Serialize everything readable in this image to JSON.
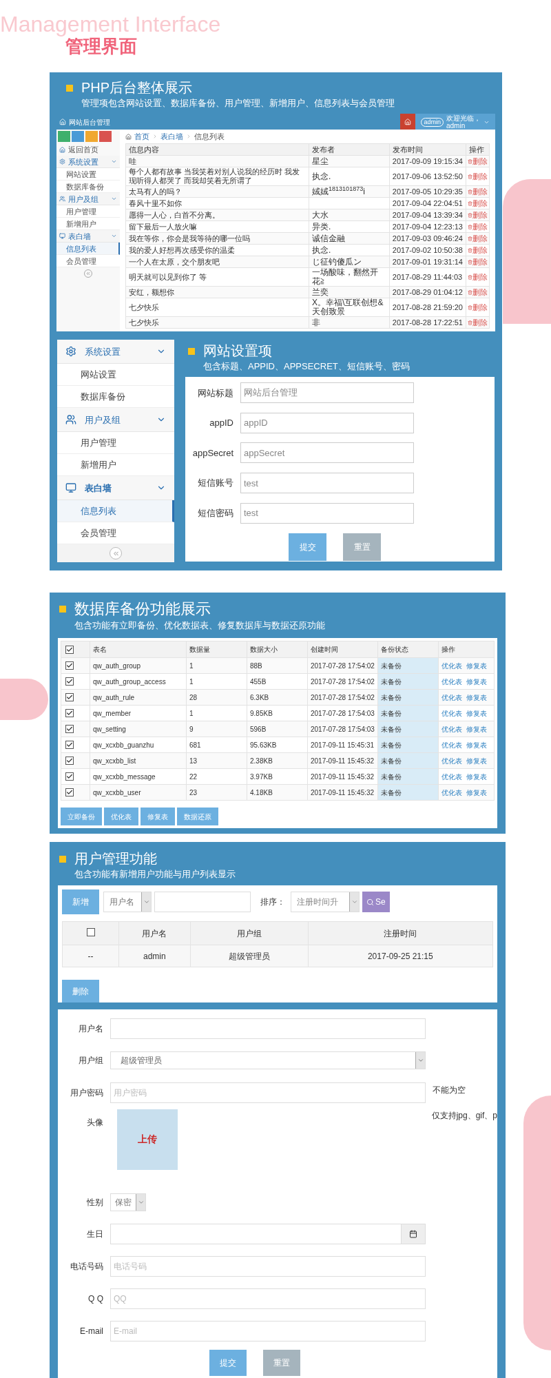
{
  "header": {
    "english": "Management Interface",
    "title": "管理界面"
  },
  "overview": {
    "title": "PHP后台整体展示",
    "subtitle": "管理项包含网站设置、数据库备份、用户管理、新增用户、信息列表与会员管理",
    "app_title": "网站后台管理",
    "avatar": "admin",
    "greeting": "欢迎光临，",
    "user": "admin",
    "toolbar": [
      {
        "color": "#3fb06c"
      },
      {
        "color": "#4a9ad6"
      },
      {
        "color": "#f0a830"
      },
      {
        "color": "#d9534f"
      }
    ],
    "breadcrumb": [
      "首页",
      "表白墙",
      "信息列表"
    ],
    "home_link": "返回首页",
    "sidebar": [
      {
        "label": "系统设置",
        "expanded": true,
        "children": [
          {
            "label": "网站设置",
            "selected": false
          },
          {
            "label": "数据库备份",
            "selected": false
          }
        ]
      },
      {
        "label": "用户及组",
        "expanded": true,
        "children": [
          {
            "label": "用户管理",
            "selected": false
          },
          {
            "label": "新增用户",
            "selected": false
          }
        ]
      },
      {
        "label": "表白墙",
        "expanded": true,
        "children": [
          {
            "label": "信息列表",
            "selected": true
          },
          {
            "label": "会员管理",
            "selected": false
          }
        ]
      }
    ],
    "columns": [
      "信息内容",
      "发布者",
      "发布时间",
      "操作"
    ],
    "rows": [
      {
        "content": "哇",
        "author": "星尘",
        "time": "2017-09-09 19:15:34",
        "action": "删除"
      },
      {
        "content": "每个人都有故事 当我笑着对别人说我的经历时 我发现听得人都哭了 而我却笑着无所谓了",
        "author": "执念.",
        "time": "2017-09-06 13:52:50",
        "action": "删除"
      },
      {
        "content": "太马有人的吗？",
        "author": "娀娀$^{1813101873}$i",
        "time": "2017-09-05 10:29:35",
        "action": "删除"
      },
      {
        "content": "春风十里不如你",
        "time": "2017-09-04 22:04:51",
        "action": "删除"
      },
      {
        "content": "愿得一人心，白首不分离。",
        "author": "大水",
        "time": "2017-09-04 13:39:34",
        "action": "删除"
      },
      {
        "content": "留下最后一人放火嘛",
        "author": "异类.",
        "time": "2017-09-04 12:23:13",
        "action": "删除"
      },
      {
        "content": "我在等你，你会是我等待的哪一位吗",
        "author": "诚信金融",
        "time": "2017-09-03 09:46:24",
        "action": "删除"
      },
      {
        "content": "我的爱人好想再次感受你的温柔",
        "author": "执念.",
        "time": "2017-09-02 10:50:38",
        "action": "删除"
      },
      {
        "content": "一个人在太原，交个朋友吧",
        "author": "じ征钓傻瓜ン",
        "time": "2017-09-01 19:31:14",
        "action": "删除"
      },
      {
        "content": "明天就可以见到你了 等",
        "author": "一场酸味，翻然开花≧",
        "time": "2017-08-29 11:44:03",
        "action": "删除"
      },
      {
        "content": "安红，额想你",
        "author": "兰奕",
        "time": "2017-08-29 01:04:12",
        "action": "删除"
      },
      {
        "content": "七夕快乐",
        "author": "X。幸福\\互联创想&天创致景",
        "time": "2017-08-28 21:59:20",
        "action": "删除"
      },
      {
        "content": "七夕快乐",
        "author": "非",
        "time": "2017-08-28 17:22:51",
        "action": "删除"
      }
    ]
  },
  "settings": {
    "title": "网站设置项",
    "subtitle": "包含标题、APPID、APPSECRET、短信账号、密码",
    "sidebar": [
      {
        "label": "系统设置",
        "expanded": true,
        "children": [
          {
            "label": "网站设置",
            "selected": false
          },
          {
            "label": "数据库备份",
            "selected": false
          }
        ]
      },
      {
        "label": "用户及组",
        "expanded": true,
        "children": [
          {
            "label": "用户管理",
            "selected": false
          },
          {
            "label": "新增用户",
            "selected": false
          }
        ]
      },
      {
        "label": "表白墙",
        "expanded": true,
        "children": [
          {
            "label": "信息列表",
            "selected": true
          },
          {
            "label": "会员管理",
            "selected": false
          }
        ]
      }
    ],
    "fields": [
      {
        "label": "网站标题",
        "value": "网站后台管理"
      },
      {
        "label": "appID",
        "value": "appID"
      },
      {
        "label": "appSecret",
        "value": "appSecret"
      },
      {
        "label": "短信账号",
        "value": "test"
      },
      {
        "label": "短信密码",
        "value": "test"
      }
    ],
    "buttons": [
      {
        "label": "提交",
        "kind": "primary"
      },
      {
        "label": "重置",
        "kind": "secondary"
      }
    ]
  },
  "backup": {
    "title": "数据库备份功能展示",
    "subtitle": "包含功能有立即备份、优化数据表、修复数据库与数据还原功能",
    "all_checked": true,
    "columns": [
      "表名",
      "数据量",
      "数据大小",
      "创建时间",
      "备份状态",
      "操作"
    ],
    "rows": [
      {
        "checked": true,
        "name": "qw_auth_group",
        "count": "1",
        "size": "88B",
        "created": "2017-07-28 17:54:02",
        "status": "未备份",
        "actions": [
          "优化表",
          "修复表"
        ]
      },
      {
        "checked": true,
        "name": "qw_auth_group_access",
        "count": "1",
        "size": "455B",
        "created": "2017-07-28 17:54:02",
        "status": "未备份",
        "actions": [
          "优化表",
          "修复表"
        ]
      },
      {
        "checked": true,
        "name": "qw_auth_rule",
        "count": "28",
        "size": "6.3KB",
        "created": "2017-07-28 17:54:02",
        "status": "未备份",
        "actions": [
          "优化表",
          "修复表"
        ]
      },
      {
        "checked": true,
        "name": "qw_member",
        "count": "1",
        "size": "9.85KB",
        "created": "2017-07-28 17:54:03",
        "status": "未备份",
        "actions": [
          "优化表",
          "修复表"
        ]
      },
      {
        "checked": true,
        "name": "qw_setting",
        "count": "9",
        "size": "596B",
        "created": "2017-07-28 17:54:03",
        "status": "未备份",
        "actions": [
          "优化表",
          "修复表"
        ]
      },
      {
        "checked": true,
        "name": "qw_xcxbb_guanzhu",
        "count": "681",
        "size": "95.63KB",
        "created": "2017-09-11 15:45:31",
        "status": "未备份",
        "actions": [
          "优化表",
          "修复表"
        ]
      },
      {
        "checked": true,
        "name": "qw_xcxbb_list",
        "count": "13",
        "size": "2.38KB",
        "created": "2017-09-11 15:45:32",
        "status": "未备份",
        "actions": [
          "优化表",
          "修复表"
        ]
      },
      {
        "checked": true,
        "name": "qw_xcxbb_message",
        "count": "22",
        "size": "3.97KB",
        "created": "2017-09-11 15:45:32",
        "status": "未备份",
        "actions": [
          "优化表",
          "修复表"
        ]
      },
      {
        "checked": true,
        "name": "qw_xcxbb_user",
        "count": "23",
        "size": "4.18KB",
        "created": "2017-09-11 15:45:32",
        "status": "未备份",
        "actions": [
          "优化表",
          "修复表"
        ]
      }
    ],
    "buttons": [
      "立即备份",
      "优化表",
      "修复表",
      "数据还原"
    ]
  },
  "users": {
    "title": "用户管理功能",
    "subtitle": "包含功能有新增用户功能与用户列表显示",
    "add_button": "新增",
    "filter_select": "用户名",
    "sort_label": "排序：",
    "sort_select": "注册时间升",
    "search_button": "Se",
    "header_checked": false,
    "columns": [
      "用户名",
      "用户组",
      "注册时间"
    ],
    "rows": [
      {
        "marker": "--",
        "name": "admin",
        "group": "超级管理员",
        "registered": "2017-09-25 21:15"
      }
    ],
    "delete_button": "删除"
  },
  "user_form": {
    "fields": [
      {
        "kind": "text",
        "label": "用户名"
      },
      {
        "kind": "select",
        "label": "用户组",
        "value": "超级管理员"
      },
      {
        "kind": "text",
        "label": "用户密码",
        "placeholder": "用户密码",
        "note": "不能为空"
      },
      {
        "kind": "upload",
        "label": "头像",
        "button": "上传",
        "note": "仅支持jpg、gif、p"
      },
      {
        "kind": "small_select",
        "label": "性别",
        "value": "保密"
      },
      {
        "kind": "date",
        "label": "生日"
      },
      {
        "kind": "text",
        "label": "电话号码",
        "placeholder": "电话号码"
      },
      {
        "kind": "text",
        "label": "Q Q",
        "placeholder": "QQ"
      },
      {
        "kind": "text",
        "label": "E-mail",
        "placeholder": "E-mail"
      }
    ],
    "buttons": [
      {
        "label": "提交",
        "kind": "primary"
      },
      {
        "label": "重置",
        "kind": "secondary"
      }
    ]
  }
}
